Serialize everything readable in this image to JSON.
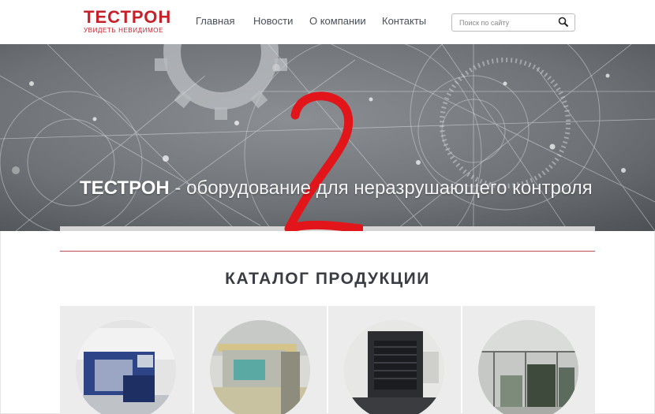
{
  "header": {
    "logo_name": "ТЕСТРОН",
    "logo_tagline": "УВИДЕТЬ НЕВИДИМОЕ",
    "nav": [
      {
        "label": "Главная"
      },
      {
        "label": "Новости"
      },
      {
        "label": "О компании"
      },
      {
        "label": "Контакты"
      }
    ],
    "search": {
      "placeholder": "Поиск по сайту",
      "icon": "search-icon"
    }
  },
  "hero": {
    "title_strong": "ТЕСТРОН",
    "title_rest": " - оборудование для неразрушающего контроля",
    "overlay_digit": "2",
    "overlay_color": "#e2151a"
  },
  "catalog": {
    "title": "КАТАЛОГ ПРОДУКЦИИ",
    "items": [
      {
        "icon": "xray-cabinet-image"
      },
      {
        "icon": "inspection-station-image"
      },
      {
        "icon": "baggage-scanner-image"
      },
      {
        "icon": "industrial-workshop-image"
      }
    ]
  },
  "colors": {
    "brand": "#c8202a",
    "nav_text": "#4a4f59",
    "divider": "#c64a4f"
  }
}
